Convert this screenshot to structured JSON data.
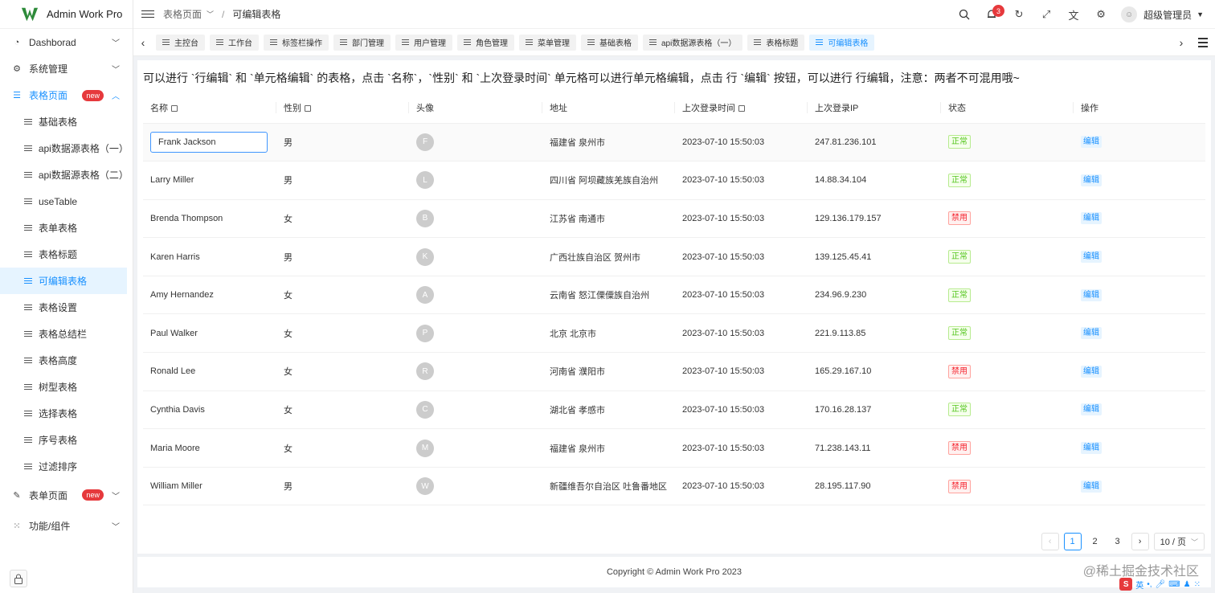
{
  "app": {
    "title": "Admin Work Pro"
  },
  "sidebar": {
    "menus": [
      {
        "label": "Dashborad",
        "icon": "dashboard-icon",
        "glyph": "◔",
        "expanded": false
      },
      {
        "label": "系统管理",
        "icon": "gear-icon",
        "glyph": "⚙",
        "expanded": false
      },
      {
        "label": "表格页面",
        "icon": "list-icon",
        "glyph": "☰",
        "expanded": true,
        "badge": "new"
      }
    ],
    "table_sub_items": [
      "基础表格",
      "api数据源表格（一）",
      "api数据源表格（二）",
      "useTable",
      "表单表格",
      "表格标题",
      "可编辑表格",
      "表格设置",
      "表格总结栏",
      "表格高度",
      "树型表格",
      "选择表格",
      "序号表格",
      "过滤排序"
    ],
    "active_sub_index": 6,
    "bottom_menus": [
      {
        "label": "表单页面",
        "icon": "form-edit-icon",
        "glyph": "✎",
        "badge": "new"
      },
      {
        "label": "功能/组件",
        "icon": "grid-icon",
        "glyph": "⁙"
      }
    ]
  },
  "header": {
    "breadcrumb_parent": "表格页面",
    "breadcrumb_current": "可编辑表格",
    "notification_count": "3",
    "user_name": "超级管理员"
  },
  "tabs": [
    "主控台",
    "工作台",
    "标签栏操作",
    "部门管理",
    "用户管理",
    "角色管理",
    "菜单管理",
    "基础表格",
    "api数据源表格（一）",
    "表格标题",
    "可编辑表格"
  ],
  "active_tab_index": 10,
  "page": {
    "description": "可以进行 `行编辑` 和 `单元格编辑` 的表格，点击 `名称`，`性别` 和 `上次登录时间` 单元格可以进行单元格编辑，点击 行 `编辑` 按钮，可以进行 行编辑，注意：两者不可混用哦~"
  },
  "table": {
    "columns": [
      "名称",
      "性别",
      "头像",
      "地址",
      "上次登录时间",
      "上次登录IP",
      "状态",
      "操作"
    ],
    "editable_columns": [
      0,
      1,
      4
    ],
    "action_label": "编辑",
    "rows": [
      {
        "name": "Frank Jackson",
        "gender": "男",
        "avatar": "F",
        "address": "福建省 泉州市",
        "time": "2023-07-10 15:50:03",
        "ip": "247.81.236.101",
        "status": "正常",
        "ok": true
      },
      {
        "name": "Larry Miller",
        "gender": "男",
        "avatar": "L",
        "address": "四川省 阿坝藏族羌族自治州",
        "time": "2023-07-10 15:50:03",
        "ip": "14.88.34.104",
        "status": "正常",
        "ok": true
      },
      {
        "name": "Brenda Thompson",
        "gender": "女",
        "avatar": "B",
        "address": "江苏省 南通市",
        "time": "2023-07-10 15:50:03",
        "ip": "129.136.179.157",
        "status": "禁用",
        "ok": false
      },
      {
        "name": "Karen Harris",
        "gender": "男",
        "avatar": "K",
        "address": "广西壮族自治区 贺州市",
        "time": "2023-07-10 15:50:03",
        "ip": "139.125.45.41",
        "status": "正常",
        "ok": true
      },
      {
        "name": "Amy Hernandez",
        "gender": "女",
        "avatar": "A",
        "address": "云南省 怒江傈僳族自治州",
        "time": "2023-07-10 15:50:03",
        "ip": "234.96.9.230",
        "status": "正常",
        "ok": true
      },
      {
        "name": "Paul Walker",
        "gender": "女",
        "avatar": "P",
        "address": "北京 北京市",
        "time": "2023-07-10 15:50:03",
        "ip": "221.9.113.85",
        "status": "正常",
        "ok": true
      },
      {
        "name": "Ronald Lee",
        "gender": "女",
        "avatar": "R",
        "address": "河南省 濮阳市",
        "time": "2023-07-10 15:50:03",
        "ip": "165.29.167.10",
        "status": "禁用",
        "ok": false
      },
      {
        "name": "Cynthia Davis",
        "gender": "女",
        "avatar": "C",
        "address": "湖北省 孝感市",
        "time": "2023-07-10 15:50:03",
        "ip": "170.16.28.137",
        "status": "正常",
        "ok": true
      },
      {
        "name": "Maria Moore",
        "gender": "女",
        "avatar": "M",
        "address": "福建省 泉州市",
        "time": "2023-07-10 15:50:03",
        "ip": "71.238.143.11",
        "status": "禁用",
        "ok": false
      },
      {
        "name": "William Miller",
        "gender": "男",
        "avatar": "W",
        "address": "新疆维吾尔自治区 吐鲁番地区",
        "time": "2023-07-10 15:50:03",
        "ip": "28.195.117.90",
        "status": "禁用",
        "ok": false
      }
    ]
  },
  "pagination": {
    "pages": [
      "1",
      "2",
      "3"
    ],
    "current": "1",
    "page_size": "10 / 页"
  },
  "footer": {
    "copyright": "Copyright © Admin Work Pro 2023"
  },
  "watermark": "@稀土掘金技术社区",
  "ime": {
    "logo": "S",
    "lang": "英"
  },
  "colors": {
    "primary": "#1890ff",
    "danger": "#e6393c",
    "success": "#52c41a"
  }
}
